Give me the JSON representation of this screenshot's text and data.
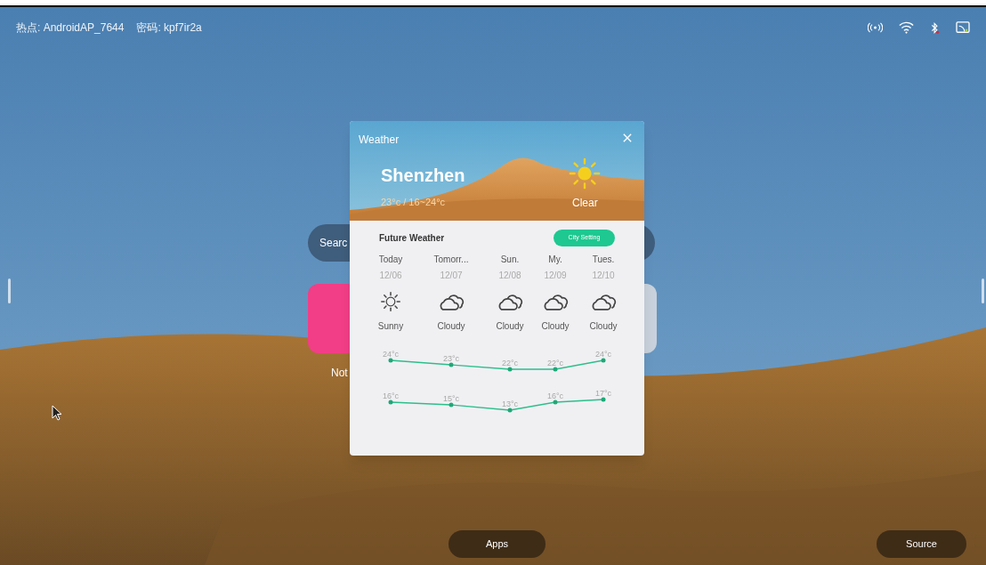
{
  "status_bar": {
    "hotspot": "热点: AndroidAP_7644",
    "password": "密码: kpf7ir2a"
  },
  "search": {
    "placeholder": "Searc"
  },
  "app_tile": {
    "label": "Not"
  },
  "weather": {
    "title": "Weather",
    "city": "Shenzhen",
    "temperature": "23°c / 16~24°c",
    "condition": "Clear",
    "section_title": "Future Weather",
    "city_button": "City Setting",
    "days": [
      {
        "name": "Today",
        "date": "12/06",
        "kind": "sunny",
        "condition": "Sunny",
        "high": "24°c",
        "low": "16°c"
      },
      {
        "name": "Tomorr...",
        "date": "12/07",
        "kind": "cloudy",
        "condition": "Cloudy",
        "high": "23°c",
        "low": "15°c"
      },
      {
        "name": "Sun.",
        "date": "12/08",
        "kind": "cloudy",
        "condition": "Cloudy",
        "high": "22°c",
        "low": "13°c"
      },
      {
        "name": "My.",
        "date": "12/09",
        "kind": "cloudy",
        "condition": "Cloudy",
        "high": "22°c",
        "low": "16°c"
      },
      {
        "name": "Tues.",
        "date": "12/10",
        "kind": "cloudy",
        "condition": "Cloudy",
        "high": "24°c",
        "low": "17°c"
      }
    ]
  },
  "dock": {
    "apps": "Apps",
    "source": "Source"
  }
}
